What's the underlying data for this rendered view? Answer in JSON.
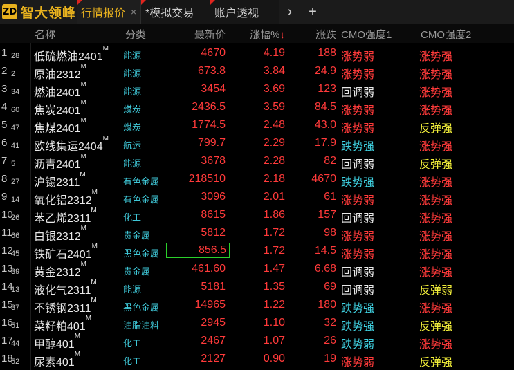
{
  "app": {
    "logo_mark": "ZD",
    "title": "智大领峰"
  },
  "tabs": [
    {
      "label": "行情报价",
      "close": "×"
    },
    {
      "label": "*模拟交易"
    },
    {
      "label": "账户透视"
    }
  ],
  "nav": {
    "more": "›",
    "add": "+"
  },
  "header": {
    "name": "名称",
    "category": "分类",
    "price": "最新价",
    "pct": "涨幅%↓",
    "chg": "涨跌",
    "cmo1": "CMO强度1",
    "cmo2": "CMO强度2"
  },
  "rows": [
    {
      "idx": "1",
      "idx2": "28",
      "name": "低硫燃油2401",
      "m": "M",
      "cat": "能源",
      "price": "4670",
      "pct": "4.19",
      "chg": "188",
      "cmo1": "涨势弱",
      "cmo1c": "red",
      "cmo2": "涨势强",
      "cmo2c": "red"
    },
    {
      "idx": "2",
      "idx2": "2",
      "name": "原油2312",
      "m": "M",
      "cat": "能源",
      "price": "673.8",
      "pct": "3.84",
      "chg": "24.9",
      "cmo1": "涨势弱",
      "cmo1c": "red",
      "cmo2": "涨势强",
      "cmo2c": "red"
    },
    {
      "idx": "3",
      "idx2": "34",
      "name": "燃油2401",
      "m": "M",
      "cat": "能源",
      "price": "3454",
      "pct": "3.69",
      "chg": "123",
      "cmo1": "回调弱",
      "cmo1c": "white",
      "cmo2": "涨势强",
      "cmo2c": "red"
    },
    {
      "idx": "4",
      "idx2": "60",
      "name": "焦炭2401",
      "m": "M",
      "cat": "煤炭",
      "price": "2436.5",
      "pct": "3.59",
      "chg": "84.5",
      "cmo1": "涨势弱",
      "cmo1c": "red",
      "cmo2": "涨势强",
      "cmo2c": "red"
    },
    {
      "idx": "5",
      "idx2": "47",
      "name": "焦煤2401",
      "m": "M",
      "cat": "煤炭",
      "price": "1774.5",
      "pct": "2.48",
      "chg": "43.0",
      "cmo1": "涨势弱",
      "cmo1c": "red",
      "cmo2": "反弹强",
      "cmo2c": "yellow"
    },
    {
      "idx": "6",
      "idx2": "41",
      "name": "欧线集运2404",
      "m": "M",
      "cat": "航运",
      "price": "799.7",
      "pct": "2.29",
      "chg": "17.9",
      "cmo1": "跌势强",
      "cmo1c": "cyan",
      "cmo2": "涨势强",
      "cmo2c": "red"
    },
    {
      "idx": "7",
      "idx2": "5",
      "name": "沥青2401",
      "m": "M",
      "cat": "能源",
      "price": "3678",
      "pct": "2.28",
      "chg": "82",
      "cmo1": "回调弱",
      "cmo1c": "white",
      "cmo2": "反弹强",
      "cmo2c": "yellow"
    },
    {
      "idx": "8",
      "idx2": "27",
      "name": "沪锡2311",
      "m": "M",
      "cat": "有色金属",
      "price": "218510",
      "pct": "2.18",
      "chg": "4670",
      "cmo1": "跌势强",
      "cmo1c": "cyan",
      "cmo2": "涨势强",
      "cmo2c": "red"
    },
    {
      "idx": "9",
      "idx2": "14",
      "name": "氧化铝2312",
      "m": "M",
      "cat": "有色金属",
      "price": "3096",
      "pct": "2.01",
      "chg": "61",
      "cmo1": "涨势弱",
      "cmo1c": "red",
      "cmo2": "涨势强",
      "cmo2c": "red"
    },
    {
      "idx": "10",
      "idx2": "26",
      "name": "苯乙烯2311",
      "m": "M",
      "cat": "化工",
      "price": "8615",
      "pct": "1.86",
      "chg": "157",
      "cmo1": "回调弱",
      "cmo1c": "white",
      "cmo2": "涨势强",
      "cmo2c": "red"
    },
    {
      "idx": "11",
      "idx2": "66",
      "name": "白银2312",
      "m": "M",
      "cat": "贵金属",
      "price": "5812",
      "pct": "1.72",
      "chg": "98",
      "cmo1": "涨势弱",
      "cmo1c": "red",
      "cmo2": "涨势强",
      "cmo2c": "red"
    },
    {
      "idx": "12",
      "idx2": "45",
      "name": "铁矿石2401",
      "m": "M",
      "cat": "黑色金属",
      "price": "856.5",
      "pct": "1.72",
      "chg": "14.5",
      "cmo1": "涨势弱",
      "cmo1c": "red",
      "cmo2": "涨势强",
      "cmo2c": "red",
      "boxed": true
    },
    {
      "idx": "13",
      "idx2": "39",
      "name": "黄金2312",
      "m": "M",
      "cat": "贵金属",
      "price": "461.60",
      "pct": "1.47",
      "chg": "6.68",
      "cmo1": "回调弱",
      "cmo1c": "white",
      "cmo2": "涨势强",
      "cmo2c": "red"
    },
    {
      "idx": "14",
      "idx2": "13",
      "name": "液化气2311",
      "m": "M",
      "cat": "能源",
      "price": "5181",
      "pct": "1.35",
      "chg": "69",
      "cmo1": "回调弱",
      "cmo1c": "white",
      "cmo2": "反弹弱",
      "cmo2c": "yellow"
    },
    {
      "idx": "15",
      "idx2": "37",
      "name": "不锈钢2311",
      "m": "M",
      "cat": "黑色金属",
      "price": "14965",
      "pct": "1.22",
      "chg": "180",
      "cmo1": "跌势强",
      "cmo1c": "cyan",
      "cmo2": "涨势强",
      "cmo2c": "red"
    },
    {
      "idx": "16",
      "idx2": "51",
      "name": "菜籽粕401",
      "m": "M",
      "cat": "油脂油料",
      "price": "2945",
      "pct": "1.10",
      "chg": "32",
      "cmo1": "跌势强",
      "cmo1c": "cyan",
      "cmo2": "反弹强",
      "cmo2c": "yellow"
    },
    {
      "idx": "17",
      "idx2": "44",
      "name": "甲醇401",
      "m": "M",
      "cat": "化工",
      "price": "2467",
      "pct": "1.07",
      "chg": "26",
      "cmo1": "跌势弱",
      "cmo1c": "cyan",
      "cmo2": "涨势强",
      "cmo2c": "red"
    },
    {
      "idx": "18",
      "idx2": "52",
      "name": "尿素401",
      "m": "M",
      "cat": "化工",
      "price": "2127",
      "pct": "0.90",
      "chg": "19",
      "cmo1": "涨势弱",
      "cmo1c": "red",
      "cmo2": "反弹强",
      "cmo2c": "yellow"
    }
  ],
  "colors": {
    "up": "#ff3a3a",
    "cyan": "#3fd0e0",
    "yellow": "#f2ee3a",
    "brand": "#e9b21e",
    "selected_outline": "#2bd02b"
  }
}
